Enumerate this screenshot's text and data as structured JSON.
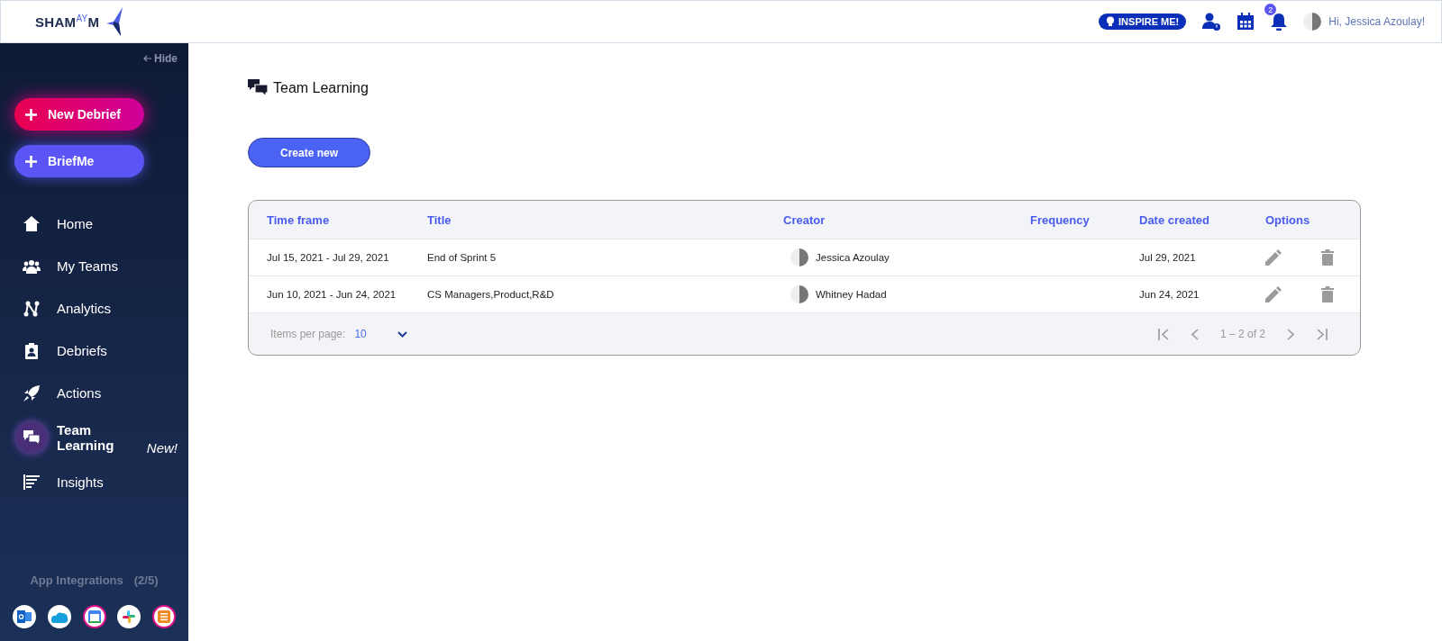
{
  "header": {
    "logo": "SHAM$^{AY}$M",
    "inspire_button": "INSPIRE ME!",
    "notifications_count": "2",
    "greeting": "Hi, Jessica Azoulay!"
  },
  "sidebar": {
    "hide_link": "Hide",
    "actions": [
      {
        "label": "New Debrief",
        "kind": "pink"
      },
      {
        "label": "BriefMe",
        "kind": "violet"
      }
    ],
    "items": [
      {
        "label": "Home",
        "selected": false
      },
      {
        "label": "My Teams",
        "selected": false
      },
      {
        "label": "Analytics",
        "selected": false
      },
      {
        "label": "Debriefs",
        "selected": false
      },
      {
        "label": "Actions",
        "selected": false
      },
      {
        "label": "Team Learning",
        "selected": true,
        "badge": "New!"
      },
      {
        "label": "Insights",
        "selected": false
      }
    ],
    "integrations_label": "App Integrations",
    "integrations_count": "(2/5)",
    "integrations": [
      {
        "connected": false
      },
      {
        "connected": false
      },
      {
        "connected": true
      },
      {
        "connected": false
      },
      {
        "connected": true
      }
    ]
  },
  "page": {
    "title": "Team Learning",
    "create_button": "Create new"
  },
  "table": {
    "columns": [
      "Time frame",
      "Title",
      "Creator",
      "Frequency",
      "Date created",
      "Options"
    ],
    "rows": [
      {
        "time_frame": "Jul 15, 2021 - Jul 29, 2021",
        "title": "End of Sprint 5",
        "creator": "Jessica Azoulay",
        "date_created": "Jul 29, 2021"
      },
      {
        "time_frame": "Jun 10, 2021 - Jun 24, 2021",
        "title": "CS Managers,Product,R&D",
        "creator": "Whitney Hadad",
        "date_created": "Jun 24, 2021"
      }
    ],
    "paginator": {
      "items_label": "Items per page:",
      "page_size": "10",
      "range": "1 – 2 of 2"
    }
  }
}
